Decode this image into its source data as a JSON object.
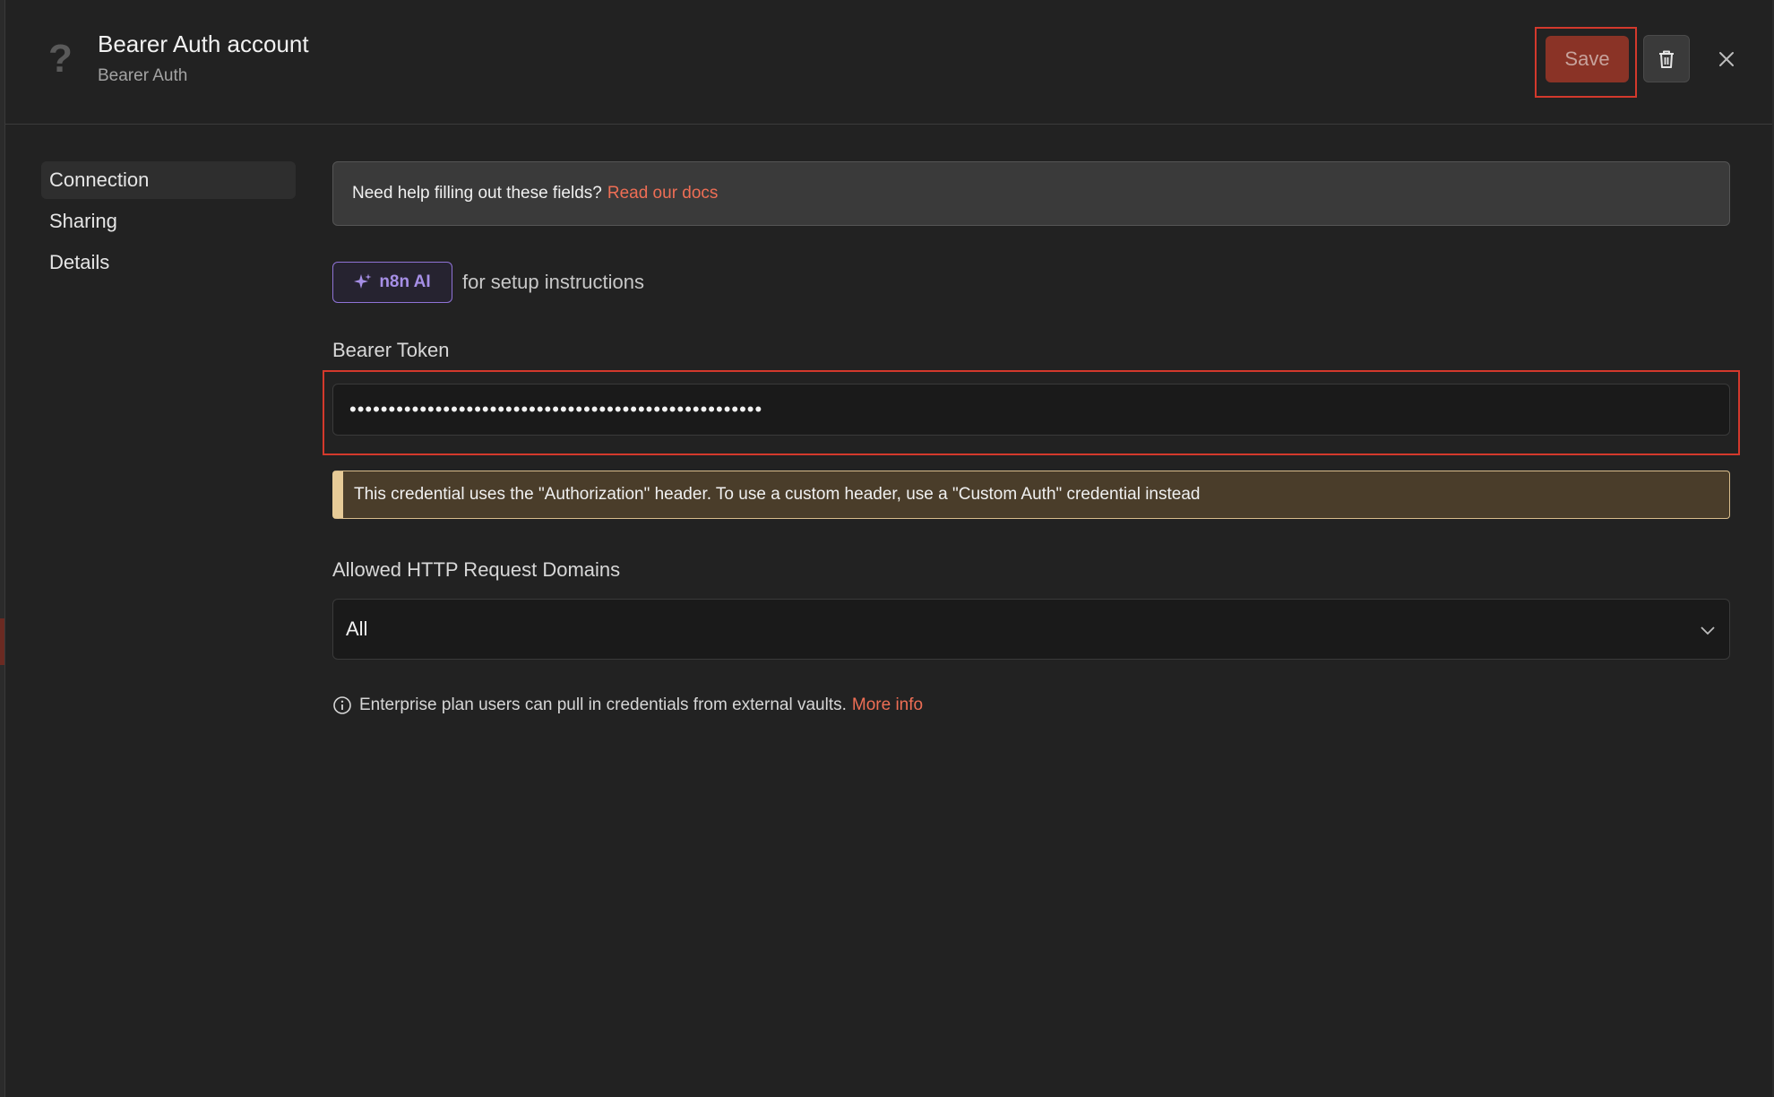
{
  "header": {
    "title": "Bearer Auth account",
    "subtitle": "Bearer Auth",
    "help_glyph": "?",
    "save_label": "Save"
  },
  "sidebar": {
    "items": [
      {
        "label": "Connection",
        "active": true
      },
      {
        "label": "Sharing",
        "active": false
      },
      {
        "label": "Details",
        "active": false
      }
    ]
  },
  "help_banner": {
    "text": "Need help filling out these fields?",
    "link": "Read our docs"
  },
  "ai_assist": {
    "button_label": "n8n AI",
    "text": "for setup instructions"
  },
  "fields": {
    "bearer_token": {
      "label": "Bearer Token",
      "value": "•••••••••••••••••••••••••••••••••••••••••••••••••••••"
    },
    "warning": "This credential uses the \"Authorization\" header. To use a custom header, use a \"Custom Auth\" credential instead",
    "allowed_domains": {
      "label": "Allowed HTTP Request Domains",
      "selected": "All"
    }
  },
  "footer_info": {
    "text": "Enterprise plan users can pull in credentials from external vaults.",
    "link": "More info"
  },
  "colors": {
    "accent": "#ee6e55",
    "save_bg": "#8a3326",
    "ai_purple": "#a68fe6",
    "warning_bg": "#4a3d2a"
  }
}
